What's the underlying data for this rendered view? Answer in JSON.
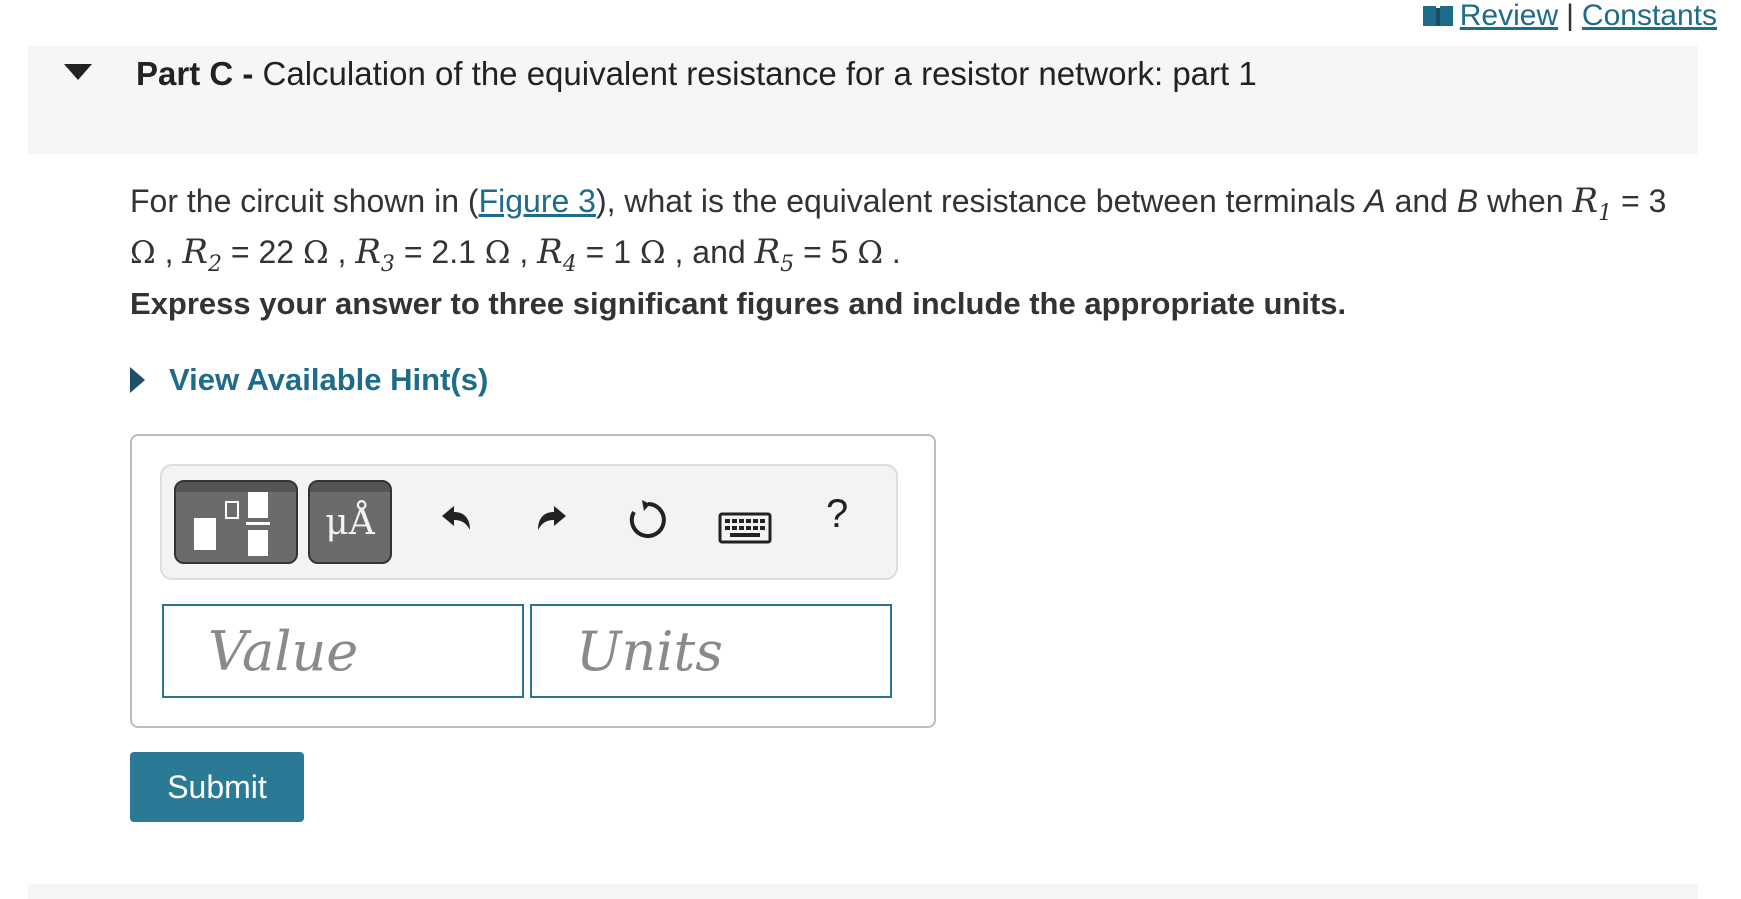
{
  "top_links": {
    "review": "Review",
    "separator": "|",
    "constants": "Constants"
  },
  "part": {
    "label": "Part C -",
    "title": "Calculation of the equivalent resistance for a resistor network: part 1"
  },
  "question": {
    "intro": "For the circuit shown in (",
    "figure_link": "Figure 3",
    "mid": "), what is the equivalent resistance between terminals",
    "terminal_a": "A",
    "and1": "and",
    "terminal_b": "B",
    "when": "when",
    "r1": "R",
    "r1_sub": "1",
    "r1_val": "3",
    "r2": "R",
    "r2_sub": "2",
    "r2_val": "22",
    "r3": "R",
    "r3_sub": "3",
    "r3_val": "2.1",
    "r4": "R",
    "r4_sub": "4",
    "r4_val": "1",
    "and2": "and",
    "r5": "R",
    "r5_sub": "5",
    "r5_val": "5",
    "ohm": "Ω"
  },
  "instruction": "Express your answer to three significant figures and include the appropriate units.",
  "hints": {
    "label": "View Available Hint(s)"
  },
  "toolbar": {
    "units_button": "μÅ",
    "help": "?"
  },
  "answer": {
    "value_placeholder": "Value",
    "units_placeholder": "Units"
  },
  "submit_label": "Submit",
  "colors": {
    "accent": "#2a7a96",
    "link": "#1f6b8a",
    "header_bg": "#f6f6f6"
  }
}
